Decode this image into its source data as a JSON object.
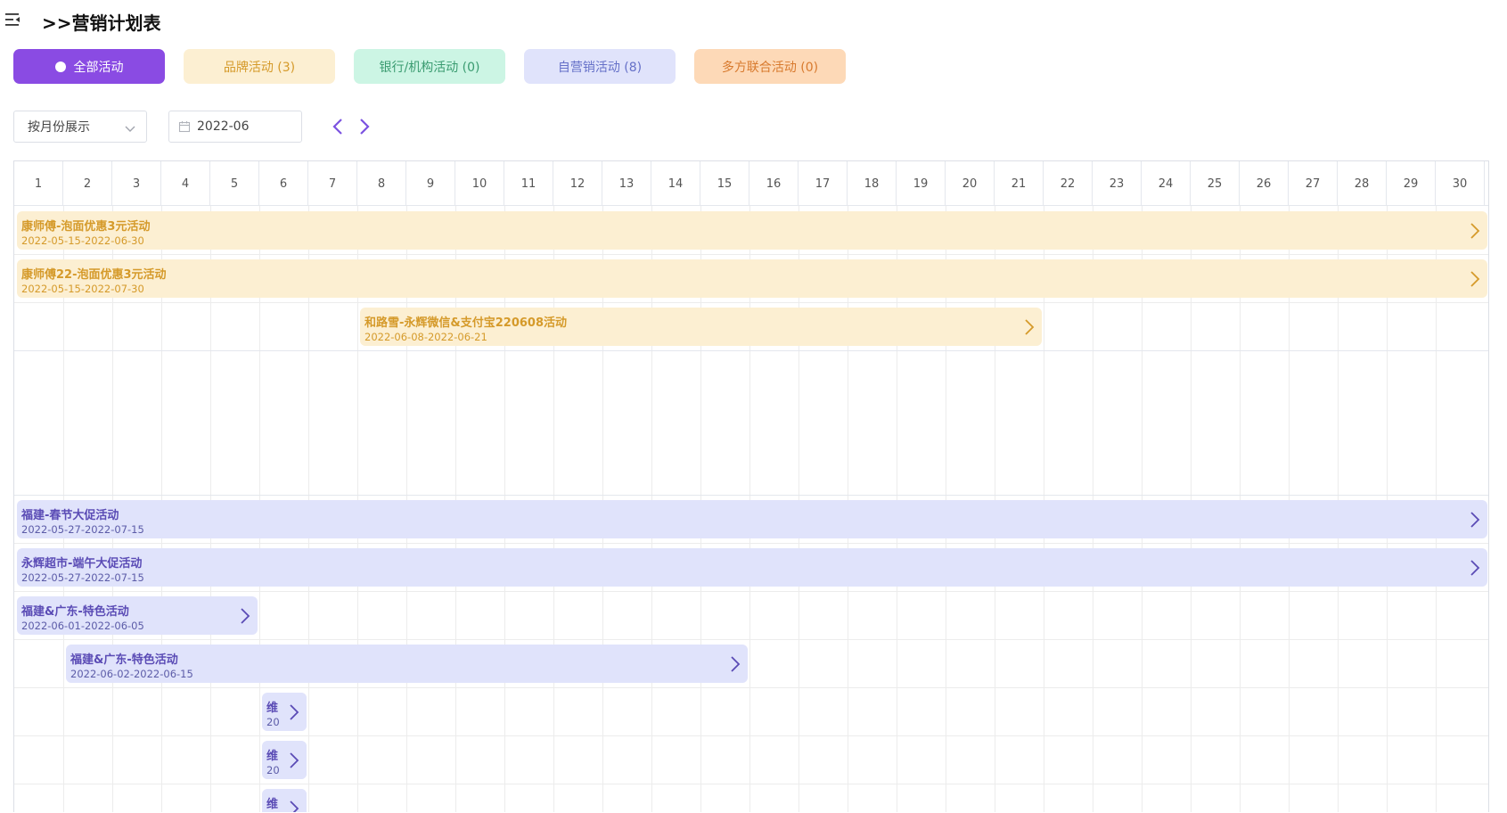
{
  "header": {
    "title": ">>营销计划表",
    "menu_icon": "menu-fold-icon"
  },
  "filters": [
    {
      "label": "全部活动",
      "bg": "#8a4be3",
      "color": "#ffffff",
      "active": true
    },
    {
      "label": "品牌活动 (3)",
      "bg": "#fcefd2",
      "color": "#d59a2a",
      "active": false
    },
    {
      "label": "银行/机构活动 (0)",
      "bg": "#ccf5e4",
      "color": "#3a9b70",
      "active": false
    },
    {
      "label": "自营销活动 (8)",
      "bg": "#e0e3fb",
      "color": "#6570c8",
      "active": false
    },
    {
      "label": "多方联合活动 (0)",
      "bg": "#fdd9b7",
      "color": "#d87a2e",
      "active": false
    }
  ],
  "controls": {
    "view_mode": "按月份展示",
    "month": "2022-06",
    "prev_icon": "chevron-left-icon",
    "next_icon": "chevron-right-icon"
  },
  "calendar": {
    "days": [
      "1",
      "2",
      "3",
      "4",
      "5",
      "6",
      "7",
      "8",
      "9",
      "10",
      "11",
      "12",
      "13",
      "14",
      "15",
      "16",
      "17",
      "18",
      "19",
      "20",
      "21",
      "22",
      "23",
      "24",
      "25",
      "26",
      "27",
      "28",
      "29",
      "30"
    ],
    "brand_events": [
      {
        "name": "康师傅-泡面优惠3元活动",
        "range": "2022-05-15-2022-06-30"
      },
      {
        "name": "康师傅22-泡面优惠3元活动",
        "range": "2022-05-15-2022-07-30"
      },
      {
        "name": "和路雪-永辉微信&支付宝220608活动",
        "range": "2022-06-08-2022-06-21"
      }
    ],
    "self_events": [
      {
        "name": "福建-春节大促活动",
        "range": "2022-05-27-2022-07-15"
      },
      {
        "name": "永辉超市-端午大促活动",
        "range": "2022-05-27-2022-07-15"
      },
      {
        "name": "福建&广东-特色活动",
        "range": "2022-06-01-2022-06-05"
      },
      {
        "name": "福建&广东-特色活动",
        "range": "2022-06-02-2022-06-15"
      },
      {
        "name": "维",
        "range": "20"
      },
      {
        "name": "维",
        "range": "20"
      },
      {
        "name": "维",
        "range": ""
      }
    ]
  }
}
